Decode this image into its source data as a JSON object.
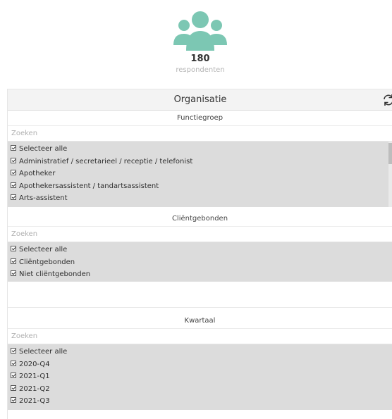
{
  "respondents": {
    "count": "180",
    "label": "respondenten",
    "icon": "users-icon",
    "icon_color": "#7cc7b3"
  },
  "panel": {
    "title": "Organisatie",
    "refresh_icon": "refresh-icon"
  },
  "sections": {
    "functiegroep": {
      "title": "Functiegroep",
      "search_placeholder": "Zoeken",
      "items": [
        "Selecteer alle",
        "Administratief / secretarieel / receptie / telefonist",
        "Apotheker",
        "Apothekersassistent / tandartsassistent",
        "Arts-assistent"
      ]
    },
    "clientgebonden": {
      "title": "Cliëntgebonden",
      "search_placeholder": "Zoeken",
      "items": [
        "Selecteer alle",
        "Cliëntgebonden",
        "Niet cliëntgebonden"
      ]
    },
    "kwartaal": {
      "title": "Kwartaal",
      "search_placeholder": "Zoeken",
      "items": [
        "Selecteer alle",
        "2020-Q4",
        "2021-Q1",
        "2021-Q2",
        "2021-Q3"
      ]
    }
  }
}
